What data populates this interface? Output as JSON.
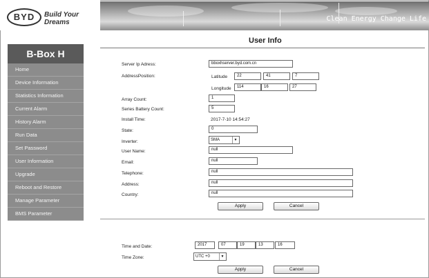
{
  "header": {
    "logo_text": "BYD",
    "tagline": "Build Your Dreams",
    "banner_text": "Clean Energy Change Life"
  },
  "sidebar": {
    "brand": "B-Box H",
    "items": [
      {
        "label": "Home"
      },
      {
        "label": "Device Information"
      },
      {
        "label": "Statistics Information"
      },
      {
        "label": "Current Alarm"
      },
      {
        "label": "History Alarm"
      },
      {
        "label": "Run Data"
      },
      {
        "label": "Set Password"
      },
      {
        "label": "User Information"
      },
      {
        "label": "Upgrade"
      },
      {
        "label": "Reboot and Restore"
      },
      {
        "label": "Manage Parameter"
      },
      {
        "label": "BMS Parameter"
      }
    ]
  },
  "main": {
    "title": "User Info",
    "form": {
      "server_ip_label": "Server Ip Adress:",
      "server_ip_value": "bboxhserver.byd.com.cn",
      "address_position_label": "AddressPosition:",
      "latitude_label": "Latitude",
      "latitude": [
        "22",
        "41",
        "7"
      ],
      "longitude_label": "Longitude",
      "longitude": [
        "114",
        "16",
        "27"
      ],
      "array_count_label": "Array Count:",
      "array_count_value": "1",
      "series_battery_label": "Series Battery Count:",
      "series_battery_value": "5",
      "install_time_label": "Install Time:",
      "install_time_value": "2017-7-10 14:54:27",
      "state_label": "State:",
      "state_value": "0",
      "inverter_label": "Inverter:",
      "inverter_value": "SMA",
      "user_name_label": "User Name:",
      "user_name_value": "null",
      "email_label": "Email:",
      "email_value": "null",
      "telephone_label": "Telephone:",
      "telephone_value": "null",
      "address_label": "Address:",
      "address_value": "null",
      "country_label": "Country:",
      "country_value": "null",
      "apply_label": "Apply",
      "cancel_label": "Cancel"
    },
    "time": {
      "time_date_label": "Time and Date:",
      "date_parts": [
        "2017",
        "07",
        "19",
        "13",
        "16"
      ],
      "timezone_label": "Time Zone:",
      "timezone_value": "UTC +0",
      "apply_label": "Apply",
      "cancel_label": "Cancel"
    }
  }
}
